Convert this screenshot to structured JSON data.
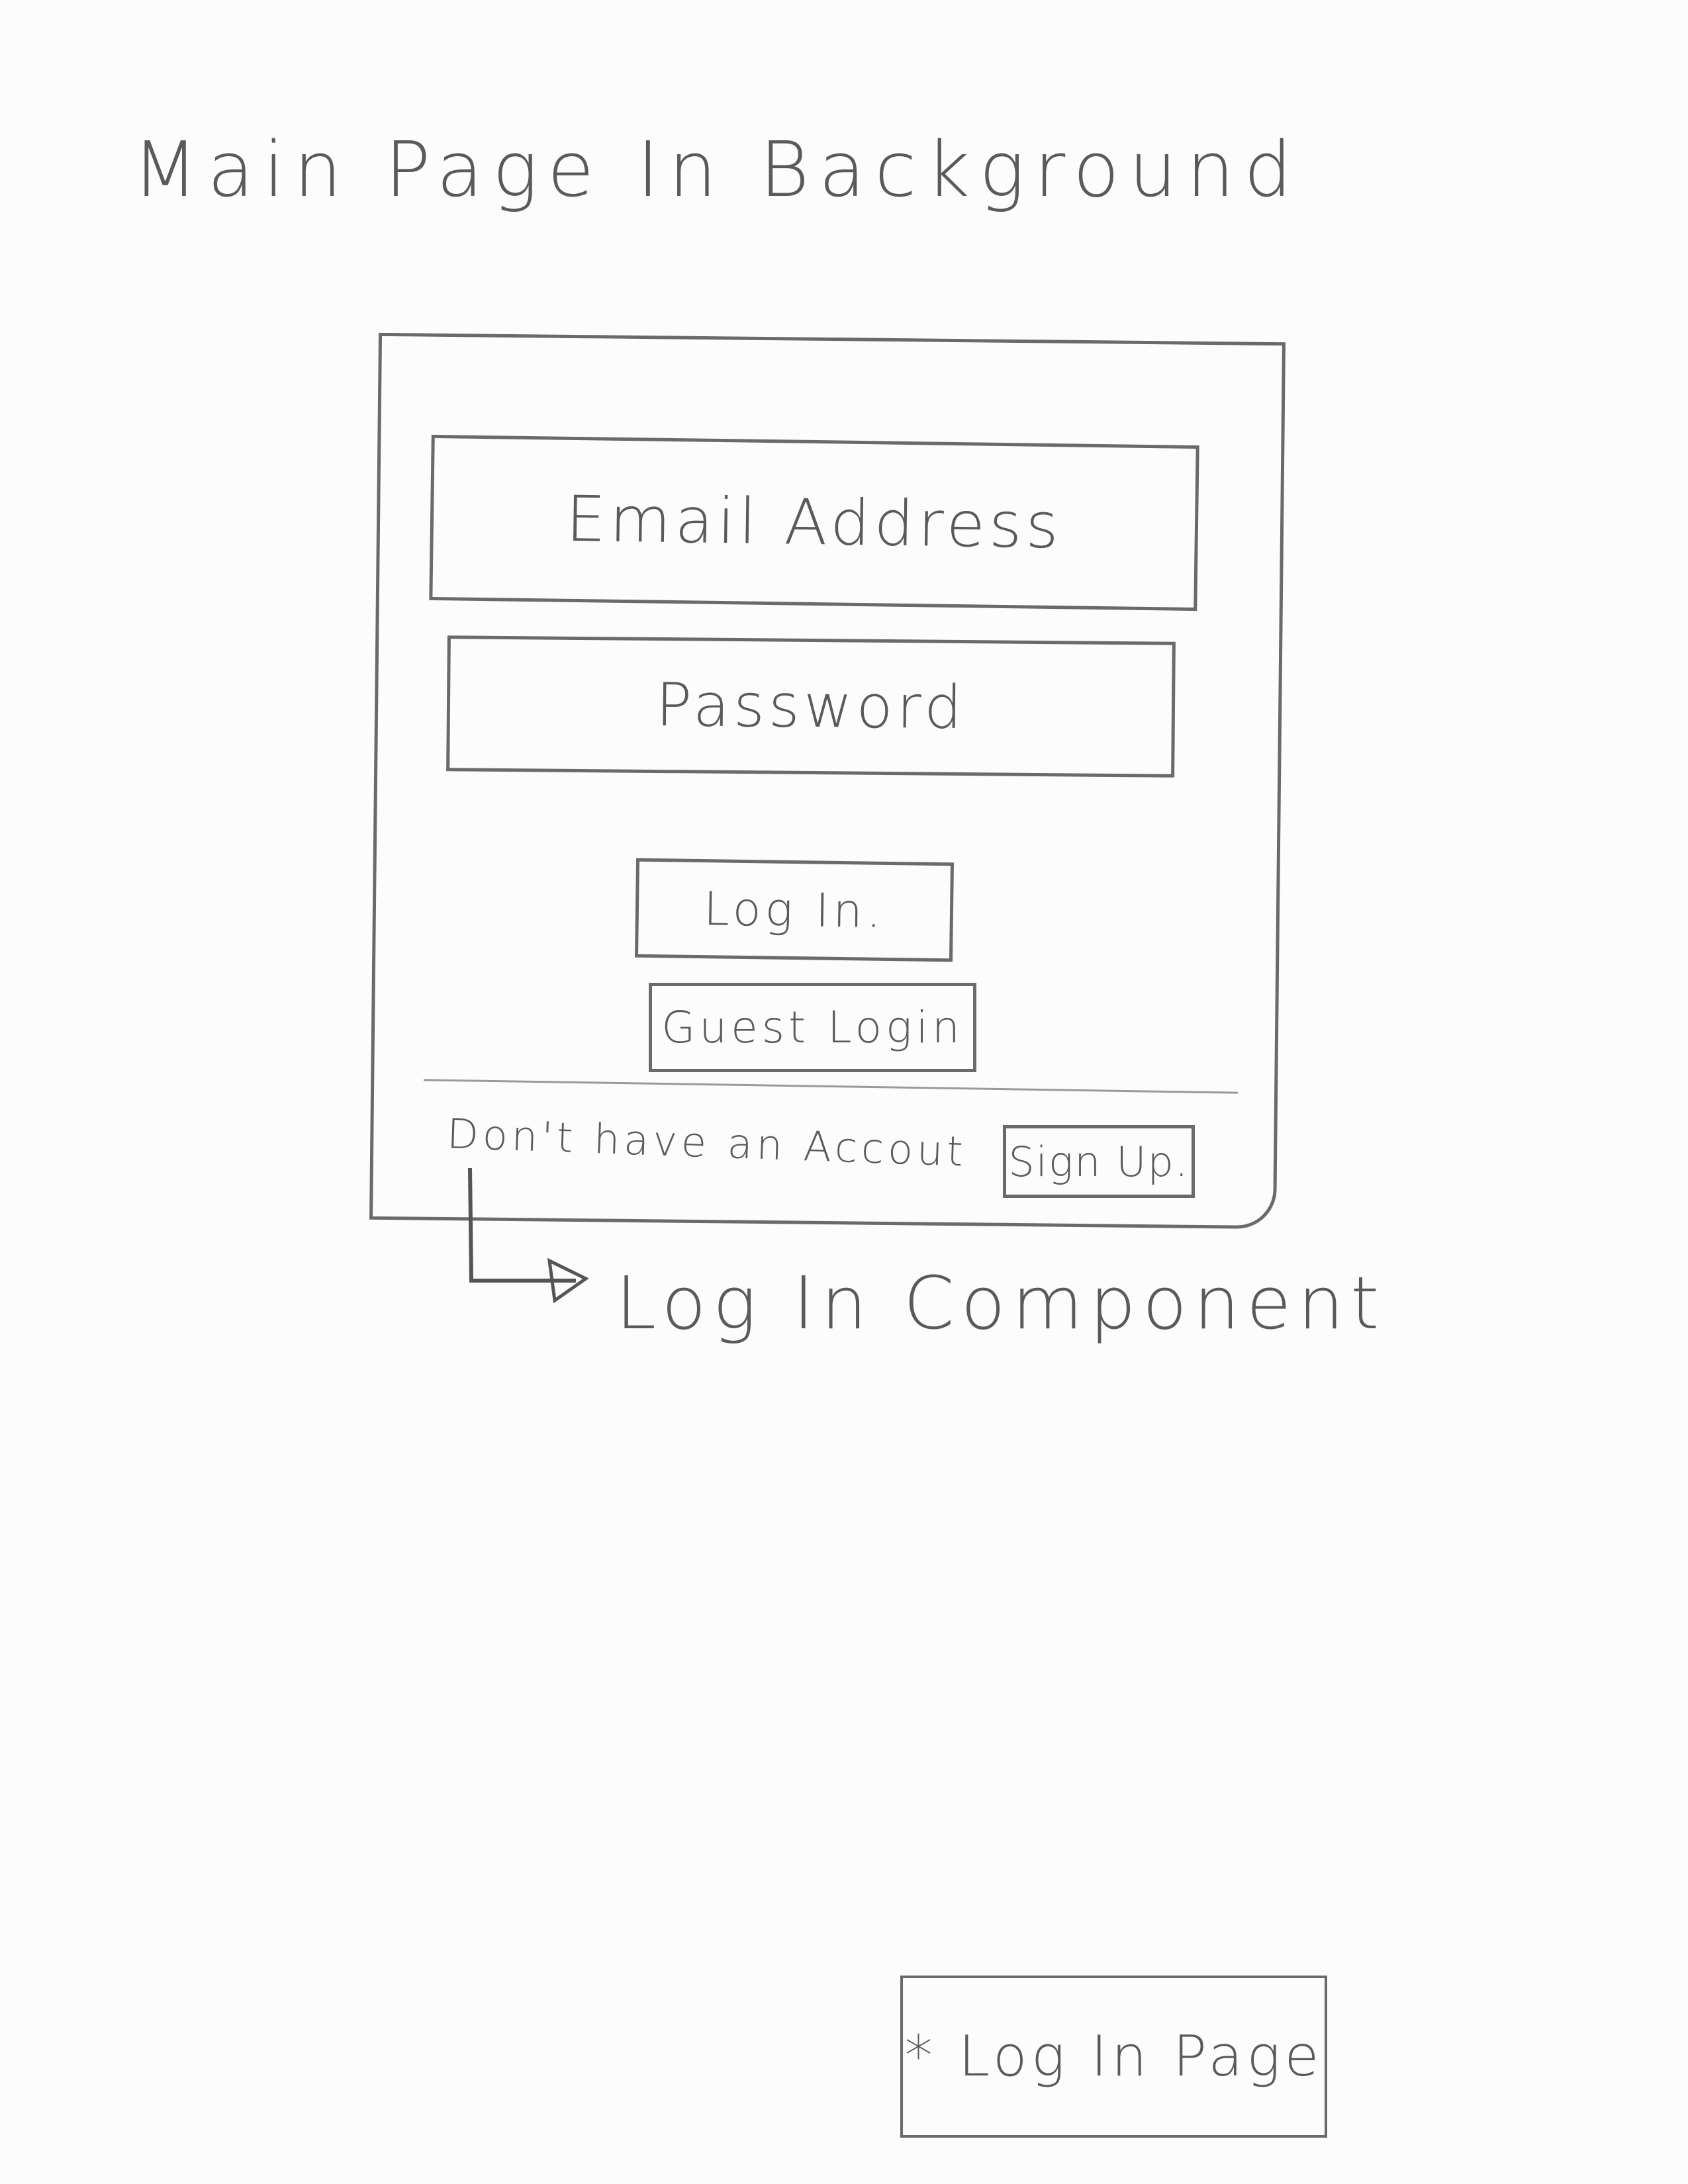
{
  "heading": "Main Page In Background",
  "login_modal": {
    "email_placeholder": "Email Address",
    "password_placeholder": "Password",
    "login_button": "Log In.",
    "guest_login_button": "Guest Login",
    "no_account_text": "Don't have an Accout",
    "signup_button": "Sign Up."
  },
  "annotation": "Log In Component",
  "page_label": "* Log In Page"
}
